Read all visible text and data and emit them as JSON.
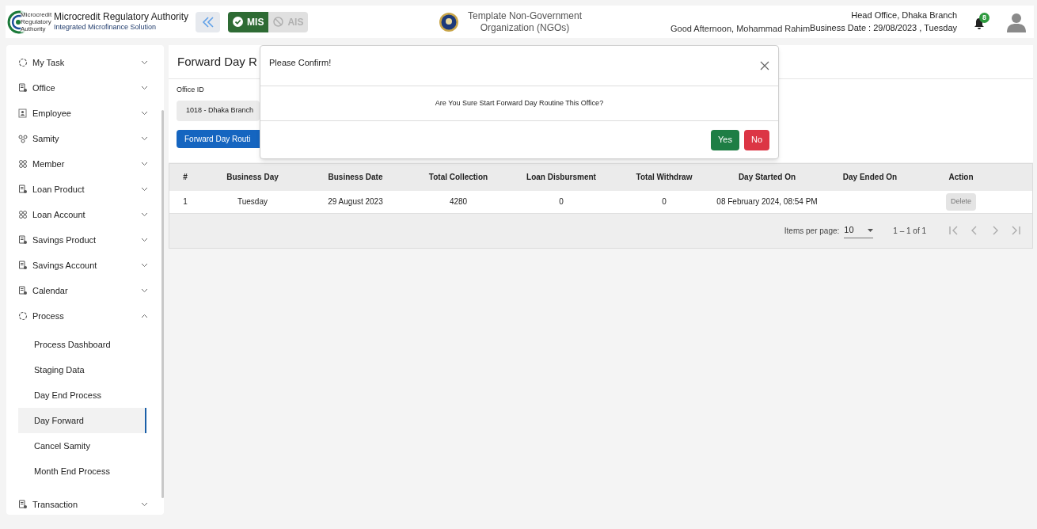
{
  "header": {
    "logo_lines": [
      "Microcredit",
      "Regulatory",
      "Authority"
    ],
    "org_name": "Microcredit Regulatory Authority",
    "org_subtitle": "Integrated Microfinance Solution",
    "modules": [
      {
        "label": "MIS",
        "selected": true
      },
      {
        "label": "AIS",
        "selected": false
      }
    ],
    "ngo_name": [
      "Template Non-Government",
      "Organization (NGOs)"
    ],
    "greeting": "Good Afternoon, Mohammad Rahim",
    "office": "Head Office, Dhaka Branch",
    "business_date": "Business Date : 29/08/2023 , Tuesday",
    "notification_count": "8"
  },
  "sidebar": {
    "items": [
      {
        "label": "My Task",
        "kind": "spinner",
        "expanded": false
      },
      {
        "label": "Office",
        "kind": "document",
        "expanded": false
      },
      {
        "label": "Employee",
        "kind": "person",
        "expanded": false
      },
      {
        "label": "Samity",
        "kind": "group",
        "expanded": false
      },
      {
        "label": "Member",
        "kind": "members",
        "expanded": false
      },
      {
        "label": "Loan Product",
        "kind": "document",
        "expanded": false
      },
      {
        "label": "Loan Account",
        "kind": "members",
        "expanded": false
      },
      {
        "label": "Savings Product",
        "kind": "document",
        "expanded": false
      },
      {
        "label": "Savings Account",
        "kind": "document",
        "expanded": false
      },
      {
        "label": "Calendar",
        "kind": "document",
        "expanded": false
      },
      {
        "label": "Process",
        "kind": "spinner",
        "expanded": true,
        "children": [
          {
            "label": "Process Dashboard",
            "selected": false
          },
          {
            "label": "Staging Data",
            "selected": false
          },
          {
            "label": "Day End Process",
            "selected": false
          },
          {
            "label": "Day Forward",
            "selected": true
          },
          {
            "label": "Cancel Samity",
            "selected": false
          },
          {
            "label": "Month End Process",
            "selected": false
          }
        ]
      },
      {
        "label": "Transaction",
        "kind": "document",
        "expanded": false
      }
    ]
  },
  "page": {
    "title": "Forward Day R",
    "office_field": {
      "label": "Office ID",
      "value": "1018 - Dhaka Branch"
    },
    "action_button": "Forward Day Routi"
  },
  "table": {
    "columns": [
      "#",
      "Business Day",
      "Business Date",
      "Total Collection",
      "Loan Disbursment",
      "Total Withdraw",
      "Day Started On",
      "Day Ended On",
      "Action"
    ],
    "rows": [
      {
        "cells": [
          "1",
          "Tuesday",
          "29 August 2023",
          "4280",
          "0",
          "0",
          "08 February 2024, 08:54 PM",
          ""
        ],
        "action": "Delete",
        "action_disabled": true
      }
    ]
  },
  "paginator": {
    "label": "Items per page:",
    "page_size": "10",
    "range": "1 – 1 of 1"
  },
  "dialog": {
    "title": "Please Confirm!",
    "message": "Are You Sure Start Forward Day Routine This Office?",
    "buttons": [
      {
        "label": "Yes",
        "kind": "confirm"
      },
      {
        "label": "No",
        "kind": "cancel"
      }
    ]
  }
}
